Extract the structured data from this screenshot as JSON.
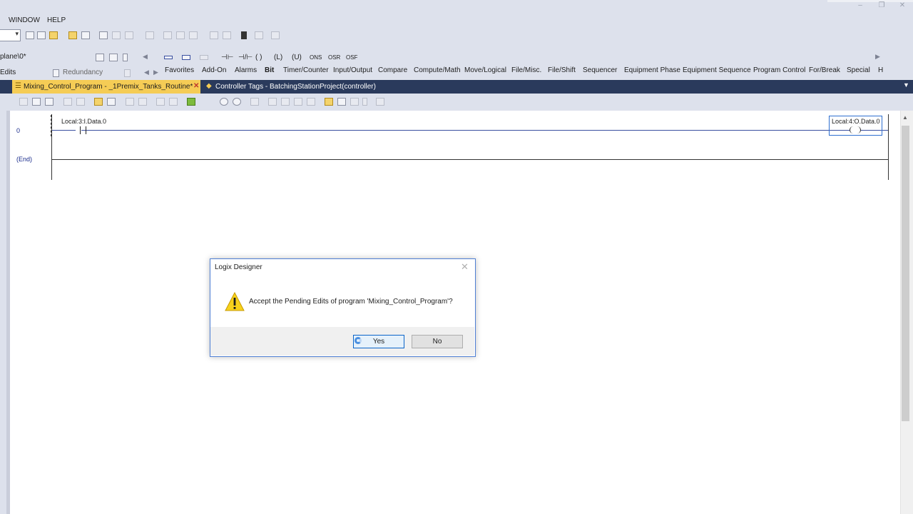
{
  "menu": {
    "window": "WINDOW",
    "help": "HELP"
  },
  "toolbar": {
    "path_fragment": "plane\\0*",
    "edits_label": "Edits",
    "redundancy_label": "Redundancy"
  },
  "instructions": [
    "⊣⊢",
    "⊣/⊢",
    "( )",
    "(L)",
    "(U)",
    "ONS",
    "OSR",
    "OSF"
  ],
  "instruction_tabs": [
    "Favorites",
    "Add-On",
    "Alarms",
    "Bit",
    "Timer/Counter",
    "Input/Output",
    "Compare",
    "Compute/Math",
    "Move/Logical",
    "File/Misc.",
    "File/Shift",
    "Sequencer",
    "Equipment Phase",
    "Equipment Sequence",
    "Program Control",
    "For/Break",
    "Special",
    "H"
  ],
  "selected_instruction_tab": "Bit",
  "doc_tabs": [
    {
      "label": "Mixing_Control_Program - _1Premix_Tanks_Routine*",
      "active": true
    },
    {
      "label": "Controller Tags - BatchingStationProject(controller)",
      "active": false
    }
  ],
  "ladder": {
    "rungs": [
      {
        "number": "0",
        "input_tag": "Local:3:I.Data.0",
        "output_tag": "Local:4:O.Data.0"
      },
      {
        "number": "(End)"
      }
    ]
  },
  "dialog": {
    "title": "Logix Designer",
    "message": "Accept the Pending Edits of program 'Mixing_Control_Program'?",
    "yes_label": "Yes",
    "no_label": "No"
  },
  "colors": {
    "tab_active": "#f5cc55",
    "tab_strip": "#2a3a5c",
    "dialog_border": "#4f7fd4"
  }
}
